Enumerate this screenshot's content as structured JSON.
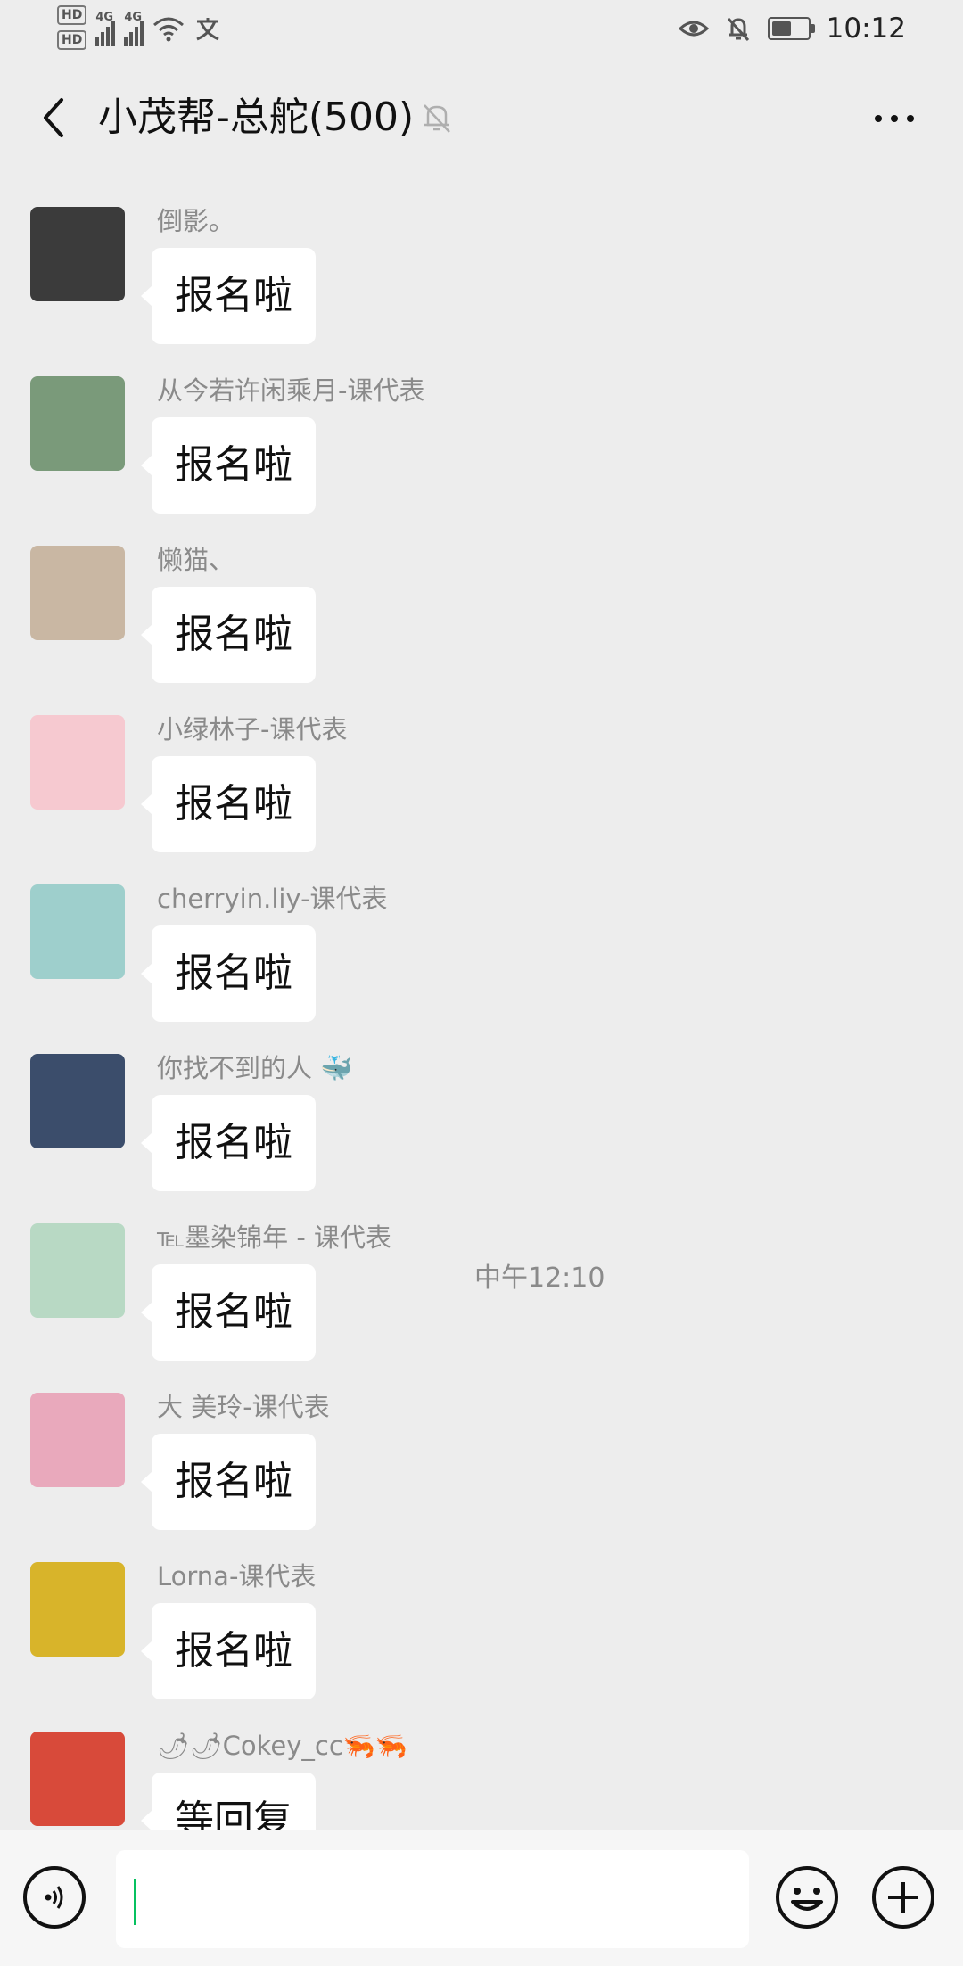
{
  "status_bar": {
    "hd1": "HD",
    "hd2": "HD",
    "net1": "4G",
    "net2": "4G",
    "time": "10:12",
    "battery_level": 0.55
  },
  "header": {
    "title": "小茂帮-总舵(500)",
    "back_icon": "chevron-left-icon",
    "mute_icon": "bell-off-icon",
    "more_icon": "more-dots-icon"
  },
  "messages": [
    {
      "sender": "倒影。",
      "text": "报名啦",
      "avatar_color": "#3b3b3b"
    },
    {
      "sender": "从今若许闲乘月-课代表",
      "text": "报名啦",
      "avatar_color": "#7a9a7a"
    },
    {
      "sender": "懒猫、",
      "text": "报名啦",
      "avatar_color": "#c9b7a3"
    },
    {
      "sender": "小绿林子-课代表",
      "text": "报名啦",
      "avatar_color": "#f6c9d0"
    },
    {
      "sender": "cherryin.liy-课代表",
      "text": "报名啦",
      "avatar_color": "#9ecfcc"
    },
    {
      "sender": "你找不到的人 🐳",
      "text": "报名啦",
      "avatar_color": "#3b4d6b"
    },
    {
      "sender": "℡墨染锦年 - 课代表",
      "text": "报名啦",
      "avatar_color": "#b8d9c4"
    },
    {
      "sender": "大 美玲-课代表",
      "text": "报名啦",
      "avatar_color": "#e9a9bc"
    },
    {
      "sender": "Lorna-课代表",
      "text": "报名啦",
      "avatar_color": "#d8b42a"
    },
    {
      "sender": "🌶🌶Cokey_cc🦐🦐",
      "text": "等回复",
      "avatar_color": "#d84a3a"
    }
  ],
  "timestamp": "中午12:10",
  "input_bar": {
    "voice_icon": "voice-icon",
    "emoji_icon": "emoji-icon",
    "plus_icon": "plus-icon",
    "caret_color": "#07C160"
  }
}
